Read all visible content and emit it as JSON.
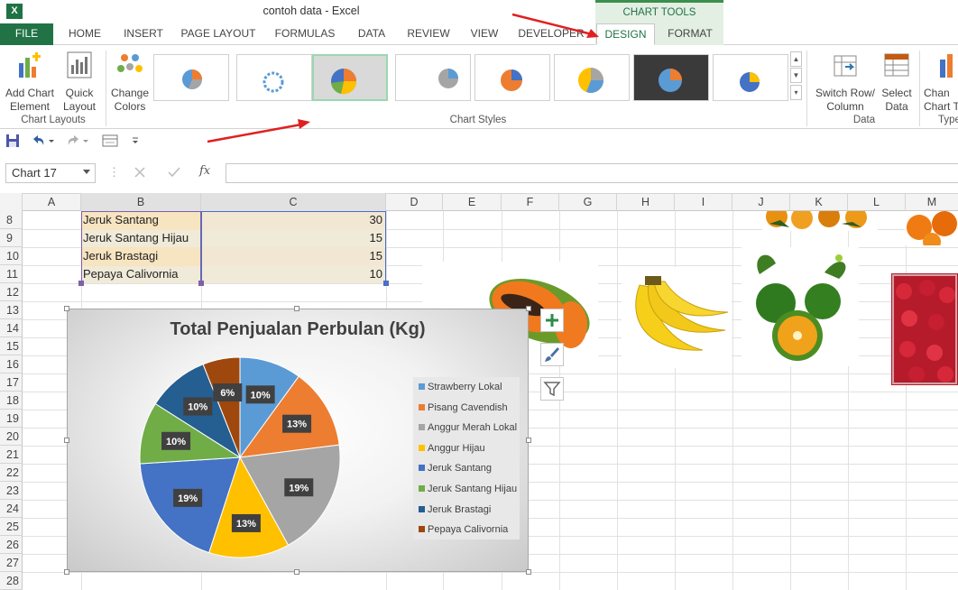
{
  "app": {
    "icon": "X",
    "title": "contoh data - Excel",
    "chart_tools_label": "CHART TOOLS"
  },
  "tabs": [
    "FILE",
    "HOME",
    "INSERT",
    "PAGE LAYOUT",
    "FORMULAS",
    "DATA",
    "REVIEW",
    "VIEW",
    "DEVELOPER",
    "DESIGN",
    "FORMAT"
  ],
  "ribbon": {
    "add_chart_element": [
      "Add Chart",
      "Element"
    ],
    "quick_layout": [
      "Quick",
      "Layout"
    ],
    "change_colors": [
      "Change",
      "Colors"
    ],
    "switch_row_column": [
      "Switch Row/",
      "Column"
    ],
    "select_data": [
      "Select",
      "Data"
    ],
    "change_chart_type": [
      "Chan",
      "Chart T"
    ],
    "groups": {
      "chart_layouts": "Chart Layouts",
      "chart_styles": "Chart Styles",
      "data": "Data",
      "type": "Type"
    }
  },
  "formula_bar": {
    "name_box": "Chart 17",
    "fx": "fx",
    "value": ""
  },
  "columns": [
    "A",
    "B",
    "C",
    "D",
    "E",
    "F",
    "G",
    "H",
    "I",
    "J",
    "K",
    "L",
    "M"
  ],
  "rows": [
    "8",
    "9",
    "10",
    "11",
    "12",
    "13",
    "14",
    "15",
    "16",
    "17",
    "18",
    "19",
    "20",
    "21",
    "22",
    "23",
    "24",
    "25",
    "26",
    "27",
    "28"
  ],
  "table": [
    {
      "name": "Jeruk Santang",
      "value": "30"
    },
    {
      "name": "Jeruk Santang Hijau",
      "value": "15"
    },
    {
      "name": "Jeruk Brastagi",
      "value": "15"
    },
    {
      "name": "Pepaya Calivornia",
      "value": "10"
    }
  ],
  "chart_data": {
    "type": "pie",
    "title": "Total Penjualan Perbulan (Kg)",
    "categories": [
      "Strawberry Lokal",
      "Pisang Cavendish",
      "Anggur Merah Lokal",
      "Anggur Hijau",
      "Jeruk Santang",
      "Jeruk Santang Hijau",
      "Jeruk Brastagi",
      "Pepaya Calivornia"
    ],
    "values": [
      10,
      13,
      19,
      13,
      19,
      10,
      10,
      6
    ],
    "labels": [
      "10%",
      "13%",
      "19%",
      "13%",
      "19%",
      "10%",
      "10%",
      "6%"
    ],
    "colors": [
      "#5b9bd5",
      "#ed7d31",
      "#a5a5a5",
      "#ffc000",
      "#4472c4",
      "#70ad47",
      "#255e91",
      "#9e480e"
    ],
    "legend": "right"
  }
}
